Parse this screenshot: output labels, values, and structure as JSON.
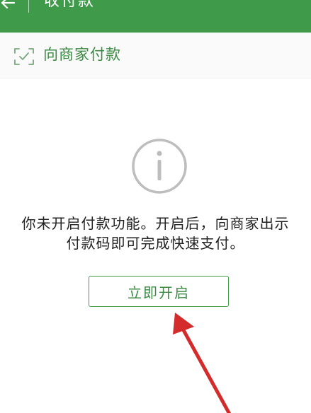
{
  "header": {
    "title": "收付款"
  },
  "pay_merchant": {
    "label": "向商家付款"
  },
  "notice": {
    "line1": "你未开启付款功能。开启后，向商家出示",
    "line2": "付款码即可完成快速支付。"
  },
  "enable_button": {
    "label": "立即开启"
  },
  "icons": {
    "back": "arrow-left-icon",
    "scan": "scan-frame-check-icon",
    "info": "info-circle-icon"
  },
  "colors": {
    "brand": "#3f9a4a",
    "brand_text": "#3c8a44",
    "annotation_arrow": "#d42b2b"
  }
}
